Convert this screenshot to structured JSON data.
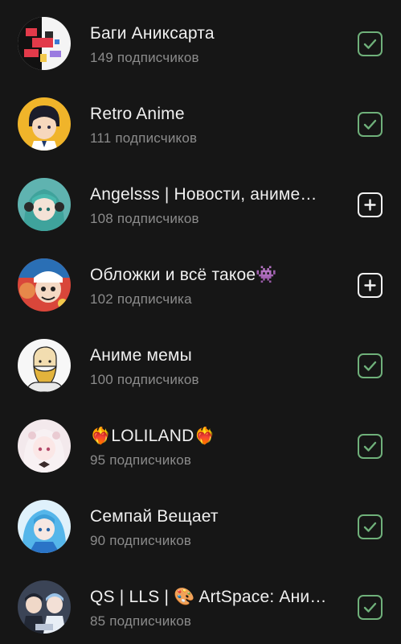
{
  "channels": [
    {
      "title": "Баги Аниксарта",
      "subscribers": "149 подписчиков",
      "action": "check",
      "action_icon": "checkmark-icon"
    },
    {
      "title": "Retro Anime",
      "subscribers": "111 подписчиков",
      "action": "check",
      "action_icon": "checkmark-icon"
    },
    {
      "title": "Angelsss | Новости, аниме…",
      "subscribers": "108 подписчиков",
      "action": "add",
      "action_icon": "plus-icon"
    },
    {
      "title": "Обложки и всё такое👾",
      "subscribers": "102 подписчика",
      "action": "add",
      "action_icon": "plus-icon"
    },
    {
      "title": "Аниме мемы",
      "subscribers": "100 подписчиков",
      "action": "check",
      "action_icon": "checkmark-icon"
    },
    {
      "title": "❤️‍🔥LOLILAND❤️‍🔥",
      "subscribers": "95 подписчиков",
      "action": "check",
      "action_icon": "checkmark-icon"
    },
    {
      "title": "Семпай Вещает",
      "subscribers": "90 подписчиков",
      "action": "check",
      "action_icon": "checkmark-icon"
    },
    {
      "title": "QS | LLS | 🎨 ArtSpace: Ани…",
      "subscribers": "85 подписчиков",
      "action": "check",
      "action_icon": "checkmark-icon"
    }
  ],
  "colors": {
    "background": "#161616",
    "title": "#f0f0f0",
    "subtitle": "#8b8b8b",
    "subscribed_accent": "#6fb07a",
    "add_accent": "#f2f2f2"
  }
}
